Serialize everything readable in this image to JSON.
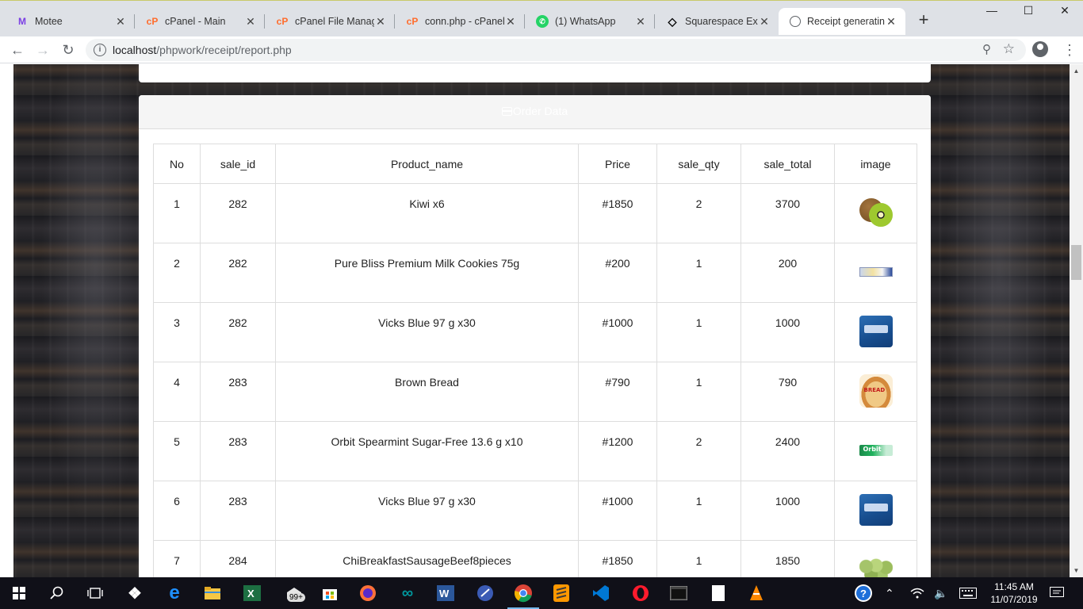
{
  "browser": {
    "tabs": [
      {
        "title": "Motee",
        "favicon": "motee-logo-icon",
        "active": false
      },
      {
        "title": "cPanel - Main",
        "favicon": "cpanel-icon",
        "active": false
      },
      {
        "title": "cPanel File Manag",
        "favicon": "cpanel-icon",
        "active": false
      },
      {
        "title": "conn.php - cPanel",
        "favicon": "cpanel-icon",
        "active": false
      },
      {
        "title": "(1) WhatsApp",
        "favicon": "whatsapp-icon",
        "active": false
      },
      {
        "title": "Squarespace Expe",
        "favicon": "squarespace-icon",
        "active": false
      },
      {
        "title": "Receipt generating",
        "favicon": "globe-icon",
        "active": true
      }
    ],
    "url_host": "localhost",
    "url_path": "/phpwork/receipt/report.php"
  },
  "panel": {
    "heading": "Order Data"
  },
  "table": {
    "headers": [
      "No",
      "sale_id",
      "Product_name",
      "Price",
      "sale_qty",
      "sale_total",
      "image"
    ],
    "rows": [
      {
        "no": "1",
        "sale_id": "282",
        "product": "Kiwi x6",
        "price": "#1850",
        "qty": "2",
        "total": "3700",
        "image": "kiwi-image"
      },
      {
        "no": "2",
        "sale_id": "282",
        "product": "Pure Bliss Premium Milk Cookies 75g",
        "price": "#200",
        "qty": "1",
        "total": "200",
        "image": "cookie-pack-image"
      },
      {
        "no": "3",
        "sale_id": "282",
        "product": "Vicks Blue 97 g x30",
        "price": "#1000",
        "qty": "1",
        "total": "1000",
        "image": "vicks-pack-image"
      },
      {
        "no": "4",
        "sale_id": "283",
        "product": "Brown Bread",
        "price": "#790",
        "qty": "1",
        "total": "790",
        "image": "bread-image"
      },
      {
        "no": "5",
        "sale_id": "283",
        "product": "Orbit Spearmint Sugar-Free 13.6 g x10",
        "price": "#1200",
        "qty": "2",
        "total": "2400",
        "image": "orbit-gum-image"
      },
      {
        "no": "6",
        "sale_id": "283",
        "product": "Vicks Blue 97 g x30",
        "price": "#1000",
        "qty": "1",
        "total": "1000",
        "image": "vicks-pack-image"
      },
      {
        "no": "7",
        "sale_id": "284",
        "product": "ChiBreakfastSausageBeef8pieces",
        "price": "#1850",
        "qty": "1",
        "total": "1850",
        "image": "sausage-image"
      }
    ]
  },
  "taskbar": {
    "notification_badge": "99+",
    "time": "11:45 AM",
    "date": "11/07/2019"
  }
}
